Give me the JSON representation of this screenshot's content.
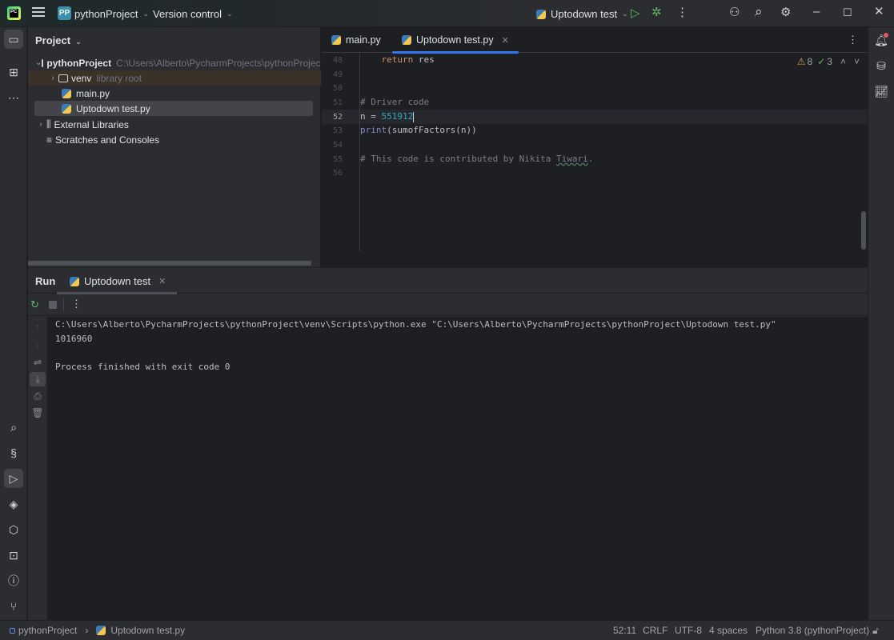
{
  "titlebar": {
    "app_logo": "PC",
    "project_badge": "PP",
    "project_name": "pythonProject",
    "version_control": "Version control",
    "run_config": "Uptodown test"
  },
  "left_strip": {
    "items": [
      "project-icon",
      "structure-icon",
      "more-icon",
      "search-icon",
      "python-console-icon",
      "run-icon",
      "layers-icon",
      "services-icon",
      "terminal-icon",
      "problems-icon",
      "git-icon"
    ]
  },
  "project_panel": {
    "title": "Project",
    "tree": [
      {
        "label": "pythonProject",
        "hint": "C:\\Users\\Alberto\\PycharmProjects\\pythonProject"
      },
      {
        "label": "venv",
        "hint": "library root"
      },
      {
        "label": "main.py"
      },
      {
        "label": "Uptodown test.py"
      },
      {
        "label": "External Libraries"
      },
      {
        "label": "Scratches and Consoles"
      }
    ]
  },
  "editor": {
    "tabs": [
      {
        "label": "main.py",
        "active": false
      },
      {
        "label": "Uptodown test.py",
        "active": true
      }
    ],
    "warnings": "8",
    "weak_warnings": "3",
    "lines": [
      {
        "num": "48",
        "indent": "    ",
        "kw": "return",
        "rest": " res"
      },
      {
        "num": "49"
      },
      {
        "num": "50"
      },
      {
        "num": "51",
        "comment": "# Driver code"
      },
      {
        "num": "52",
        "lhs": "n = ",
        "value": "551912"
      },
      {
        "num": "53",
        "builtin": "print",
        "rest": "(sumofFactors(n))"
      },
      {
        "num": "54"
      },
      {
        "num": "55",
        "comment_pre": "# This code is contributed by Nikita ",
        "comment_name": "Tiwari",
        "comment_post": "."
      },
      {
        "num": "56"
      }
    ]
  },
  "run_panel": {
    "title": "Run",
    "tab": "Uptodown test",
    "console": [
      "C:\\Users\\Alberto\\PycharmProjects\\pythonProject\\venv\\Scripts\\python.exe \"C:\\Users\\Alberto\\PycharmProjects\\pythonProject\\Uptodown test.py\"",
      "1016960",
      "",
      "Process finished with exit code 0"
    ]
  },
  "statusbar": {
    "breadcrumb_project": "pythonProject",
    "breadcrumb_file": "Uptodown test.py",
    "position": "52:11",
    "line_sep": "CRLF",
    "encoding": "UTF-8",
    "indent": "4 spaces",
    "interpreter": "Python 3.8 (pythonProject)"
  }
}
